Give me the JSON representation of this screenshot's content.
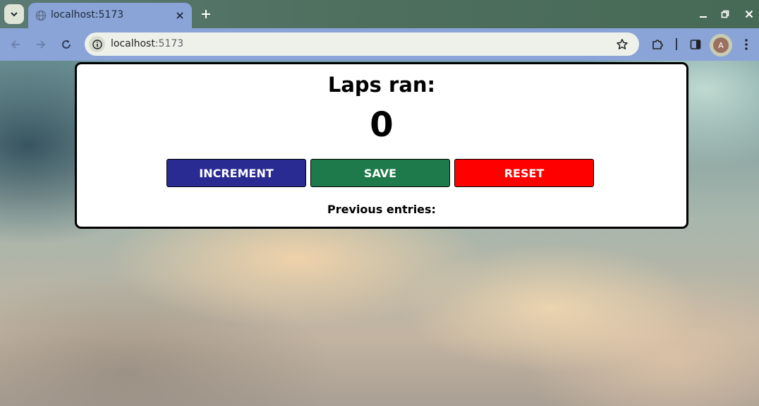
{
  "browser": {
    "tab_title": "localhost:5173",
    "url_host": "localhost",
    "url_port": ":5173",
    "profile_initial": "A"
  },
  "app": {
    "heading": "Laps ran:",
    "count": "0",
    "buttons": {
      "increment": "INCREMENT",
      "save": "SAVE",
      "reset": "RESET"
    },
    "previous_entries_label": "Previous entries:"
  },
  "colors": {
    "increment": "#2a2a93",
    "save": "#1e7a4a",
    "reset": "#ff0000",
    "chrome_accent": "#8aa4d8"
  },
  "icons": {
    "tab_search": "chevron-down-icon",
    "favicon": "globe-icon",
    "tab_close": "close-icon",
    "new_tab": "plus-icon",
    "back": "arrow-left-icon",
    "forward": "arrow-right-icon",
    "reload": "reload-icon",
    "site_info": "info-icon",
    "bookmark": "star-icon",
    "extensions": "puzzle-icon",
    "side_panel": "side-panel-icon",
    "menu": "kebab-menu-icon"
  }
}
